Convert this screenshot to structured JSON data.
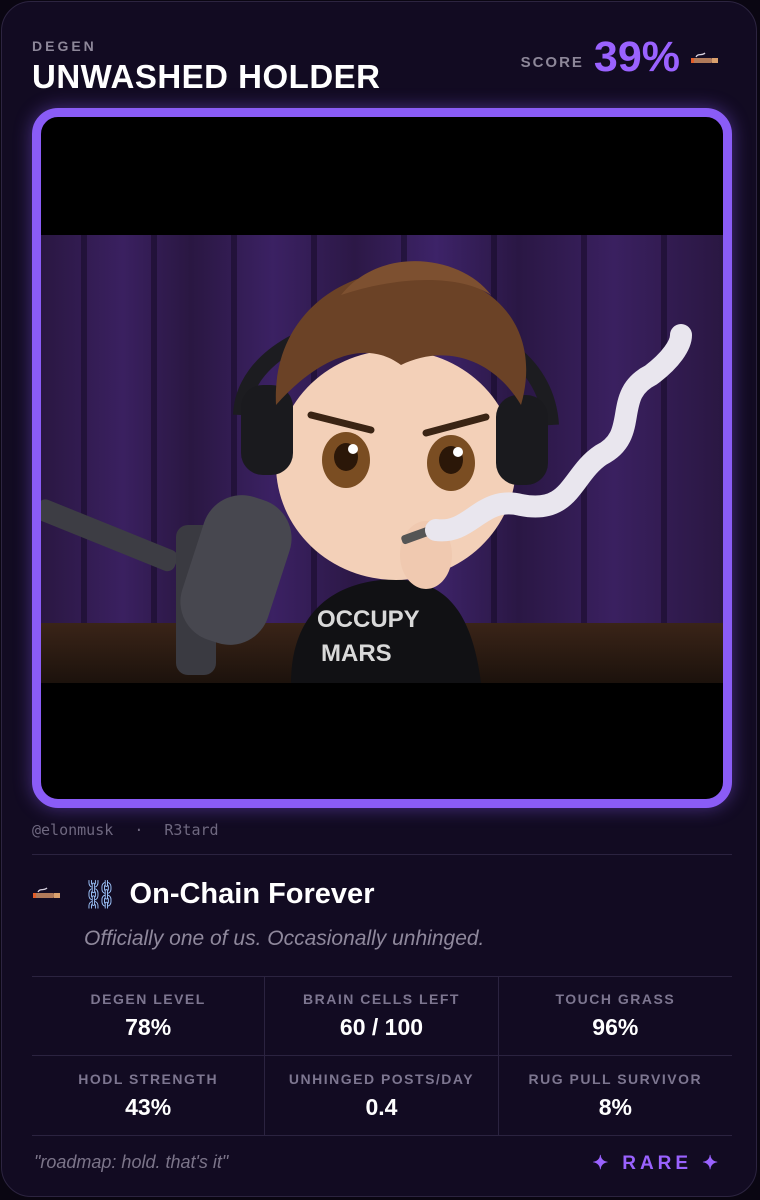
{
  "card": {
    "kicker": "DEGEN",
    "title": "UNWASHED HOLDER",
    "score_label": "SCORE",
    "score_value": "39%"
  },
  "artwork": {
    "description_icon": "chibi-figure-with-headphones-smoking",
    "shirt_text_line1": "OCCUPY",
    "shirt_text_line2": "MARS"
  },
  "meta": {
    "handle": "@elonmusk",
    "separator": "·",
    "alias": "R3tard"
  },
  "status": {
    "icon": "cigarette-icon",
    "chain_glyph": "⛓",
    "title": "On-Chain Forever",
    "tagline": "Officially one of us. Occasionally unhinged."
  },
  "stats": [
    {
      "label": "DEGEN LEVEL",
      "value": "78%"
    },
    {
      "label": "BRAIN CELLS LEFT",
      "value": "60 / 100"
    },
    {
      "label": "TOUCH GRASS",
      "value": "96%"
    },
    {
      "label": "HODL STRENGTH",
      "value": "43%"
    },
    {
      "label": "UNHINGED POSTS/DAY",
      "value": "0.4"
    },
    {
      "label": "RUG PULL SURVIVOR",
      "value": "8%"
    }
  ],
  "footer": {
    "quote": "\"roadmap: hold. that's it\"",
    "rarity": "RARE",
    "rarity_glyph": "✦"
  },
  "colors": {
    "accent": "#9a62ff",
    "frame": "#8a5cf6",
    "background": "#120b22"
  }
}
